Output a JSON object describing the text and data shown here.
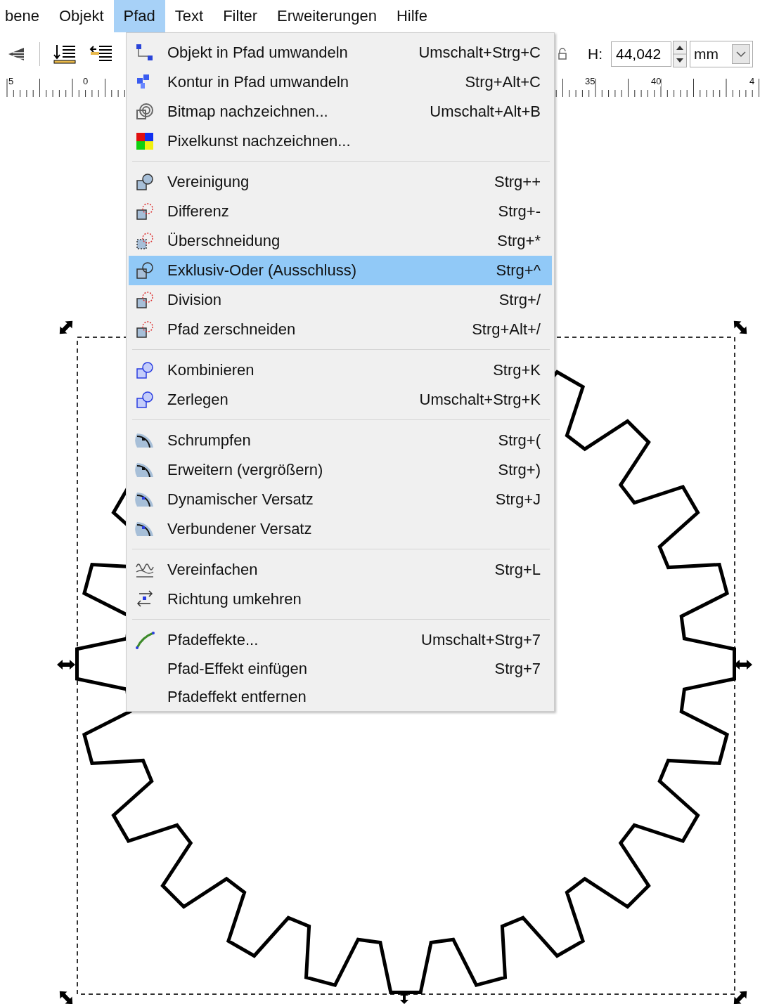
{
  "menubar": [
    {
      "label": "bene",
      "selected": false
    },
    {
      "label": "Objekt",
      "selected": false
    },
    {
      "label": "Pfad",
      "selected": true
    },
    {
      "label": "Text",
      "selected": false
    },
    {
      "label": "Filter",
      "selected": false
    },
    {
      "label": "Erweiterungen",
      "selected": false
    },
    {
      "label": "Hilfe",
      "selected": false
    }
  ],
  "toolbar": {
    "height_label": "H:",
    "height_value": "44,042",
    "unit": "mm"
  },
  "ruler": {
    "labels": [
      "5",
      "0",
      "35",
      "40",
      "4"
    ]
  },
  "menu": {
    "groups": [
      [
        {
          "label": "Objekt in Pfad umwandeln",
          "shortcut": "Umschalt+Strg+C",
          "selected": false
        },
        {
          "label": "Kontur in Pfad umwandeln",
          "shortcut": "Strg+Alt+C",
          "selected": false
        },
        {
          "label": "Bitmap nachzeichnen...",
          "shortcut": "Umschalt+Alt+B",
          "selected": false
        },
        {
          "label": "Pixelkunst nachzeichnen...",
          "selected": false
        }
      ],
      [
        {
          "label": "Vereinigung",
          "shortcut": "Strg++",
          "selected": false
        },
        {
          "label": "Differenz",
          "shortcut": "Strg+-",
          "selected": false
        },
        {
          "label": "Überschneidung",
          "shortcut": "Strg+*",
          "selected": false
        },
        {
          "label": "Exklusiv-Oder (Ausschluss)",
          "shortcut": "Strg+^",
          "selected": true
        },
        {
          "label": "Division",
          "shortcut": "Strg+/",
          "selected": false
        },
        {
          "label": "Pfad zerschneiden",
          "shortcut": "Strg+Alt+/",
          "selected": false
        }
      ],
      [
        {
          "label": "Kombinieren",
          "shortcut": "Strg+K",
          "selected": false
        },
        {
          "label": "Zerlegen",
          "shortcut": "Umschalt+Strg+K",
          "selected": false
        }
      ],
      [
        {
          "label": "Schrumpfen",
          "shortcut": "Strg+(",
          "selected": false
        },
        {
          "label": "Erweitern (vergrößern)",
          "shortcut": "Strg+)",
          "selected": false
        },
        {
          "label": "Dynamischer Versatz",
          "shortcut": "Strg+J",
          "selected": false
        },
        {
          "label": "Verbundener Versatz",
          "selected": false
        }
      ],
      [
        {
          "label": "Vereinfachen",
          "shortcut": "Strg+L",
          "selected": false
        },
        {
          "label": "Richtung umkehren",
          "selected": false
        }
      ],
      [
        {
          "label": "Pfadeffekte...",
          "shortcut": "Umschalt+Strg+7",
          "selected": false
        },
        {
          "label": "Pfad-Effekt einfügen",
          "shortcut": "Strg+7",
          "selected": false
        },
        {
          "label": "Pfadeffekt entfernen",
          "selected": false
        }
      ]
    ]
  }
}
